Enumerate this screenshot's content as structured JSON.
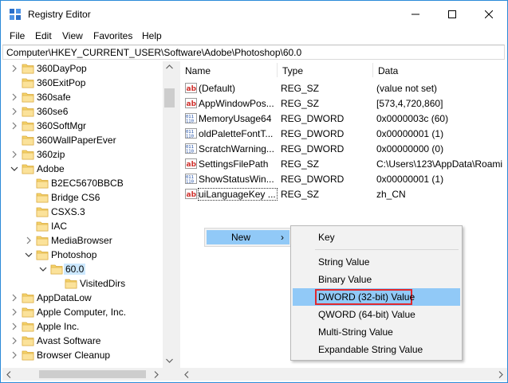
{
  "window": {
    "title": "Registry Editor",
    "accent": "#2b8ad8"
  },
  "menubar": [
    "File",
    "Edit",
    "View",
    "Favorites",
    "Help"
  ],
  "address": "Computer\\HKEY_CURRENT_USER\\Software\\Adobe\\Photoshop\\60.0",
  "tree": [
    {
      "label": "360DayPop",
      "expander": "collapsed"
    },
    {
      "label": "360ExitPop",
      "expander": "none"
    },
    {
      "label": "360safe",
      "expander": "collapsed"
    },
    {
      "label": "360se6",
      "expander": "collapsed"
    },
    {
      "label": "360SoftMgr",
      "expander": "collapsed"
    },
    {
      "label": "360WallPaperEver",
      "expander": "none"
    },
    {
      "label": "360zip",
      "expander": "collapsed"
    },
    {
      "label": "Adobe",
      "expander": "expanded"
    },
    {
      "label": "B2EC5670BBCB",
      "expander": "none"
    },
    {
      "label": "Bridge CS6",
      "expander": "none"
    },
    {
      "label": "CSXS.3",
      "expander": "none"
    },
    {
      "label": "IAC",
      "expander": "none"
    },
    {
      "label": "MediaBrowser",
      "expander": "collapsed"
    },
    {
      "label": "Photoshop",
      "expander": "expanded"
    },
    {
      "label": "60.0",
      "expander": "expanded",
      "selected": true
    },
    {
      "label": "VisitedDirs",
      "expander": "none"
    },
    {
      "label": "AppDataLow",
      "expander": "collapsed"
    },
    {
      "label": "Apple Computer, Inc.",
      "expander": "collapsed"
    },
    {
      "label": "Apple Inc.",
      "expander": "collapsed"
    },
    {
      "label": "Avast Software",
      "expander": "collapsed"
    },
    {
      "label": "Browser Cleanup",
      "expander": "collapsed"
    }
  ],
  "columns": {
    "name": "Name",
    "type": "Type",
    "data": "Data"
  },
  "values": [
    {
      "name": "(Default)",
      "type": "REG_SZ",
      "data": "(value not set)",
      "icon": "ab"
    },
    {
      "name": "AppWindowPos...",
      "type": "REG_SZ",
      "data": "[573,4,720,860]",
      "icon": "ab"
    },
    {
      "name": "MemoryUsage64",
      "type": "REG_DWORD",
      "data": "0x0000003c (60)",
      "icon": "bin"
    },
    {
      "name": "oldPaletteFontT...",
      "type": "REG_DWORD",
      "data": "0x00000001 (1)",
      "icon": "bin"
    },
    {
      "name": "ScratchWarning...",
      "type": "REG_DWORD",
      "data": "0x00000000 (0)",
      "icon": "bin"
    },
    {
      "name": "SettingsFilePath",
      "type": "REG_SZ",
      "data": "C:\\Users\\123\\AppData\\Roami",
      "icon": "ab"
    },
    {
      "name": "ShowStatusWin...",
      "type": "REG_DWORD",
      "data": "0x00000001 (1)",
      "icon": "bin"
    },
    {
      "name": "uiLanguageKey ...",
      "type": "REG_SZ",
      "data": "zh_CN",
      "icon": "ab",
      "focused": true
    }
  ],
  "context_menu": {
    "new_label": "New",
    "arrow": "›",
    "submenu": [
      {
        "label": "Key"
      },
      {
        "separator": true
      },
      {
        "label": "String Value"
      },
      {
        "label": "Binary Value"
      },
      {
        "label": "DWORD (32-bit) Value",
        "highlighted": true
      },
      {
        "label": "QWORD (64-bit) Value"
      },
      {
        "label": "Multi-String Value"
      },
      {
        "label": "Expandable String Value"
      }
    ]
  },
  "colors": {
    "highlight": "#91c9f7",
    "selection": "#cce8ff",
    "annotation_box": "#e0282d",
    "folder": "#f5d36b"
  }
}
